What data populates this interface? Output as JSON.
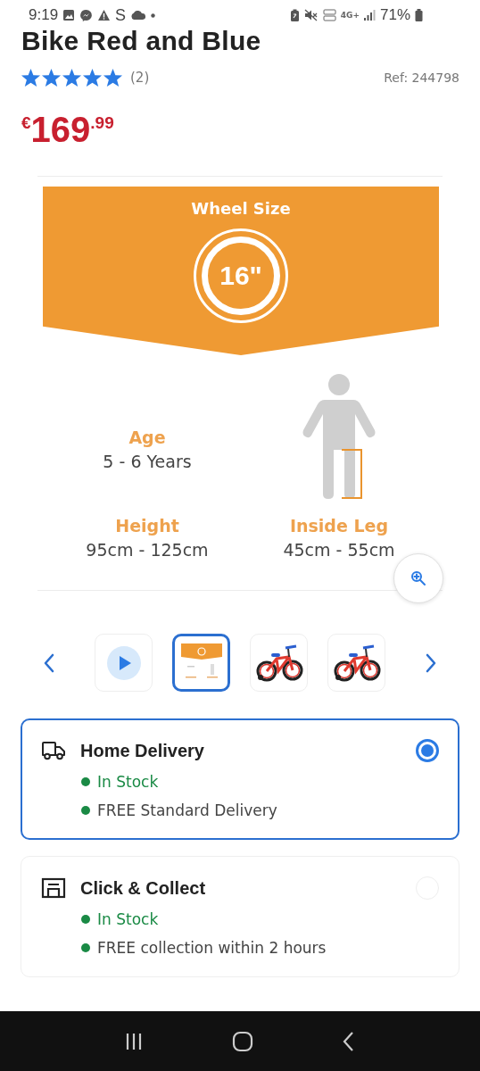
{
  "status_bar": {
    "time": "9:19",
    "notification_letter": "S",
    "network_type": "4G+",
    "battery": "71%"
  },
  "product": {
    "title": "Bike Red and Blue",
    "stars": 5,
    "review_count": "(2)",
    "ref": "Ref: 244798",
    "price_currency": "€",
    "price_main": "169",
    "price_cents": ".99"
  },
  "infographic": {
    "banner_title": "Wheel Size",
    "wheel_size": "16\"",
    "specs": [
      {
        "label": "Age",
        "value": "5 - 6 Years"
      },
      {
        "label": "Height",
        "value": "95cm - 125cm"
      },
      {
        "label": "Inside Leg",
        "value": "45cm - 55cm"
      }
    ]
  },
  "thumbnails": [
    {
      "kind": "video",
      "selected": false
    },
    {
      "kind": "infographic",
      "selected": true
    },
    {
      "kind": "picture",
      "selected": false
    },
    {
      "kind": "picture",
      "selected": false
    }
  ],
  "delivery_options": [
    {
      "kind": "delivery",
      "title": "Home Delivery",
      "selected": true,
      "lines": [
        {
          "kind": "stock",
          "text": "In Stock"
        },
        {
          "kind": "info",
          "text": "FREE Standard Delivery"
        }
      ]
    },
    {
      "kind": "collect",
      "title": "Click & Collect",
      "selected": false,
      "lines": [
        {
          "kind": "stock",
          "text": "In Stock"
        },
        {
          "kind": "info",
          "text": "FREE collection within 2 hours"
        }
      ]
    }
  ]
}
